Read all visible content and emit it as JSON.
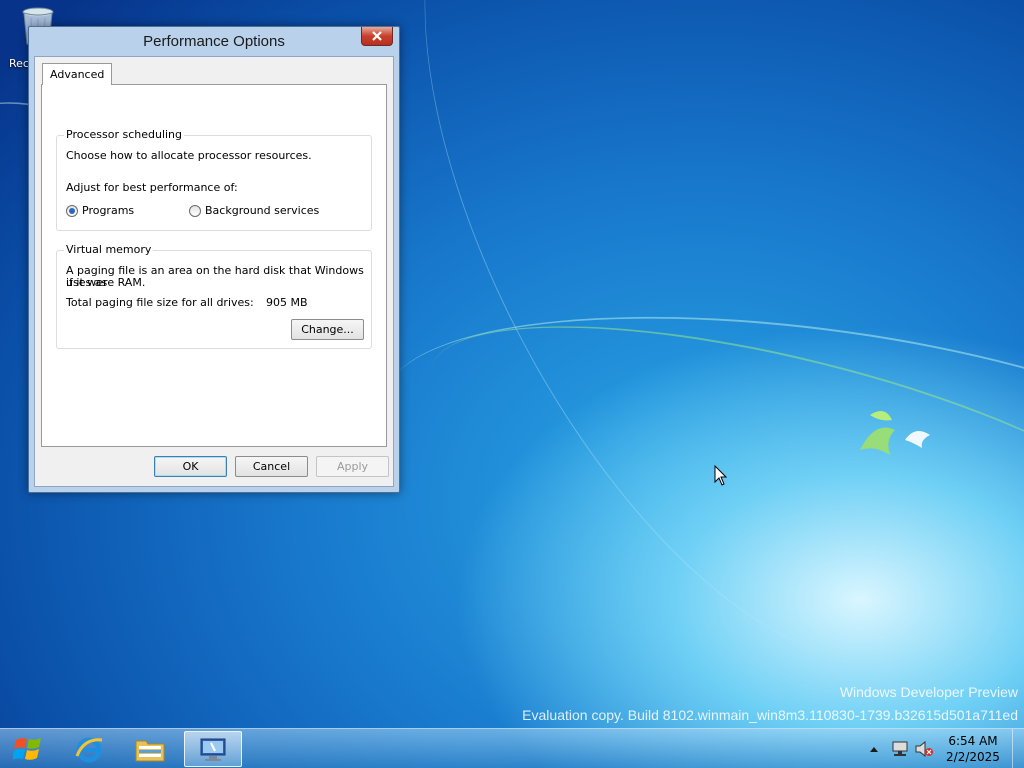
{
  "desktop": {
    "recycle_bin_label": "Rec",
    "watermark_line1": "Windows Developer Preview",
    "watermark_line2": "Evaluation copy. Build 8102.winmain_win8m3.110830-1739.b32615d501a711ed"
  },
  "window": {
    "title": "Performance Options",
    "tabs": [
      {
        "label": "Advanced",
        "selected": true
      }
    ],
    "processor_scheduling": {
      "caption": "Processor scheduling",
      "description": "Choose how to allocate processor resources.",
      "adjust_label": "Adjust for best performance of:",
      "options": [
        {
          "label": "Programs",
          "selected": true
        },
        {
          "label": "Background services",
          "selected": false
        }
      ]
    },
    "virtual_memory": {
      "caption": "Virtual memory",
      "description_line1": "A paging file is an area on the hard disk that Windows uses as",
      "description_line2": "if it were RAM.",
      "total_label": "Total paging file size for all drives:",
      "total_value": "905 MB",
      "change_button": "Change..."
    },
    "buttons": {
      "ok": "OK",
      "cancel": "Cancel",
      "apply": "Apply"
    }
  },
  "taskbar": {
    "items": [
      {
        "name": "Internet Explorer",
        "icon": "ie-icon"
      },
      {
        "name": "Windows Explorer",
        "icon": "folder-icon"
      },
      {
        "name": "System Properties",
        "icon": "system-properties-icon",
        "active": true
      }
    ],
    "clock": {
      "time": "6:54 AM",
      "date": "2/2/2025"
    }
  },
  "colors": {
    "accent": "#2a67c7",
    "close_red": "#c7402e"
  }
}
